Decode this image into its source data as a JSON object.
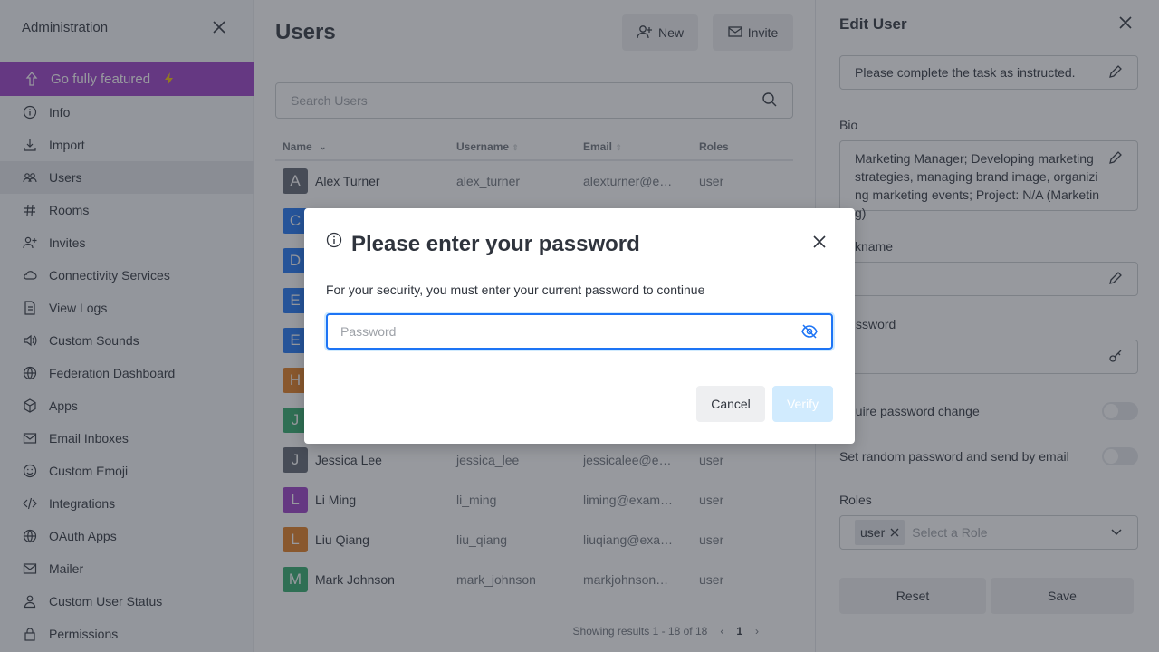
{
  "sidebar": {
    "title": "Administration",
    "feature": {
      "label": "Go fully featured",
      "color": "#9b3dc7"
    },
    "items": [
      {
        "label": "Info",
        "icon": "info-icon"
      },
      {
        "label": "Import",
        "icon": "import-icon"
      },
      {
        "label": "Users",
        "icon": "users-icon",
        "active": true
      },
      {
        "label": "Rooms",
        "icon": "hashtag-icon"
      },
      {
        "label": "Invites",
        "icon": "user-plus-icon"
      },
      {
        "label": "Connectivity Services",
        "icon": "cloud-icon"
      },
      {
        "label": "View Logs",
        "icon": "file-icon"
      },
      {
        "label": "Custom Sounds",
        "icon": "sound-icon"
      },
      {
        "label": "Federation Dashboard",
        "icon": "globe-icon"
      },
      {
        "label": "Apps",
        "icon": "cube-icon"
      },
      {
        "label": "Email Inboxes",
        "icon": "mail-icon"
      },
      {
        "label": "Custom Emoji",
        "icon": "emoji-icon"
      },
      {
        "label": "Integrations",
        "icon": "code-icon"
      },
      {
        "label": "OAuth Apps",
        "icon": "globe-icon"
      },
      {
        "label": "Mailer",
        "icon": "mail-icon"
      },
      {
        "label": "Custom User Status",
        "icon": "user-icon"
      },
      {
        "label": "Permissions",
        "icon": "lock-icon"
      }
    ]
  },
  "main": {
    "title": "Users",
    "new_label": "New",
    "invite_label": "Invite",
    "search_placeholder": "Search Users",
    "columns": {
      "name": "Name",
      "username": "Username",
      "email": "Email",
      "roles": "Roles"
    },
    "rows": [
      {
        "initial": "A",
        "color": "#5e6470",
        "name": "Alex Turner",
        "username": "alex_turner",
        "email": "alexturner@e…",
        "roles": "user"
      },
      {
        "initial": "C",
        "color": "#1d74f5",
        "name": "",
        "username": "",
        "email": "",
        "roles": ""
      },
      {
        "initial": "D",
        "color": "#1d74f5",
        "name": "",
        "username": "",
        "email": "",
        "roles": ""
      },
      {
        "initial": "E",
        "color": "#1d74f5",
        "name": "",
        "username": "",
        "email": "",
        "roles": ""
      },
      {
        "initial": "E",
        "color": "#1d74f5",
        "name": "",
        "username": "",
        "email": "",
        "roles": ""
      },
      {
        "initial": "H",
        "color": "#e27c1f",
        "name": "",
        "username": "",
        "email": "",
        "roles": ""
      },
      {
        "initial": "J",
        "color": "#2eaa6a",
        "name": "",
        "username": "",
        "email": "",
        "roles": ""
      },
      {
        "initial": "J",
        "color": "#5e6470",
        "name": "Jessica Lee",
        "username": "jessica_lee",
        "email": "jessicalee@e…",
        "roles": "user"
      },
      {
        "initial": "L",
        "color": "#9b3dc7",
        "name": "Li Ming",
        "username": "li_ming",
        "email": "liming@exam…",
        "roles": "user"
      },
      {
        "initial": "L",
        "color": "#e27c1f",
        "name": "Liu Qiang",
        "username": "liu_qiang",
        "email": "liuqiang@exa…",
        "roles": "user"
      },
      {
        "initial": "M",
        "color": "#2eaa6a",
        "name": "Mark Johnson",
        "username": "mark_johnson",
        "email": "markjohnson…",
        "roles": "user"
      }
    ],
    "pagination": {
      "summary": "Showing results 1 - 18 of 18",
      "current_page": "1"
    }
  },
  "edit_user": {
    "title": "Edit User",
    "status_text_value": "Please complete the task as instructed.",
    "bio_label": "Bio",
    "bio_value": "Marketing Manager; Developing marketing strategies, managing brand image, organizing marketing events; Project: N/A (Marketing)",
    "nickname_label": "ckname",
    "password_label": "ssword",
    "require_password_change_label": "quire password change",
    "random_password_label": "Set random password and send by email",
    "roles_label": "Roles",
    "role_chip": "user",
    "roles_placeholder": "Select a Role",
    "reset_label": "Reset",
    "save_label": "Save"
  },
  "modal": {
    "title": "Please enter your password",
    "description": "For your security, you must enter your current password to continue",
    "password_placeholder": "Password",
    "password_value": "",
    "cancel_label": "Cancel",
    "verify_label": "Verify",
    "accent": "#1d74f5"
  }
}
